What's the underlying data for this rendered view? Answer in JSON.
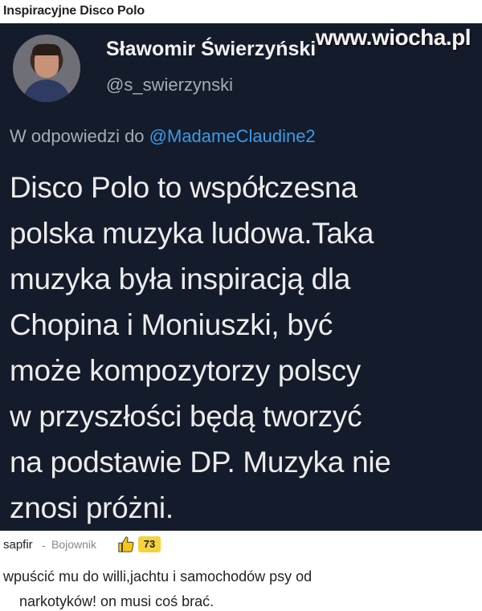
{
  "page": {
    "title": "Inspiracyjne Disco Polo",
    "watermark": "www.wiocha.pl"
  },
  "tweet": {
    "author_name": "Sławomir Świerzyński",
    "author_handle": "@s_swierzynski",
    "reply_prefix": "W odpowiedzi do ",
    "reply_mention": "@MadameClaudine2",
    "text_lines": [
      "Disco Polo to współczesna",
      "polska muzyka ludowa.Taka",
      "muzyka była inspiracją dla",
      "Chopina i Moniuszki, być",
      "może kompozytorzy polscy",
      "w przyszłości będą tworzyć",
      "na podstawie DP. Muzyka nie",
      "znosi próżni."
    ]
  },
  "comment": {
    "user": "sapfir",
    "separator": "-",
    "rank": "Bojownik",
    "score": "73",
    "text_lines": [
      "wpuścić mu do willi,jachtu i samochodów psy od",
      "narkotyków! on musi coś brać."
    ]
  }
}
